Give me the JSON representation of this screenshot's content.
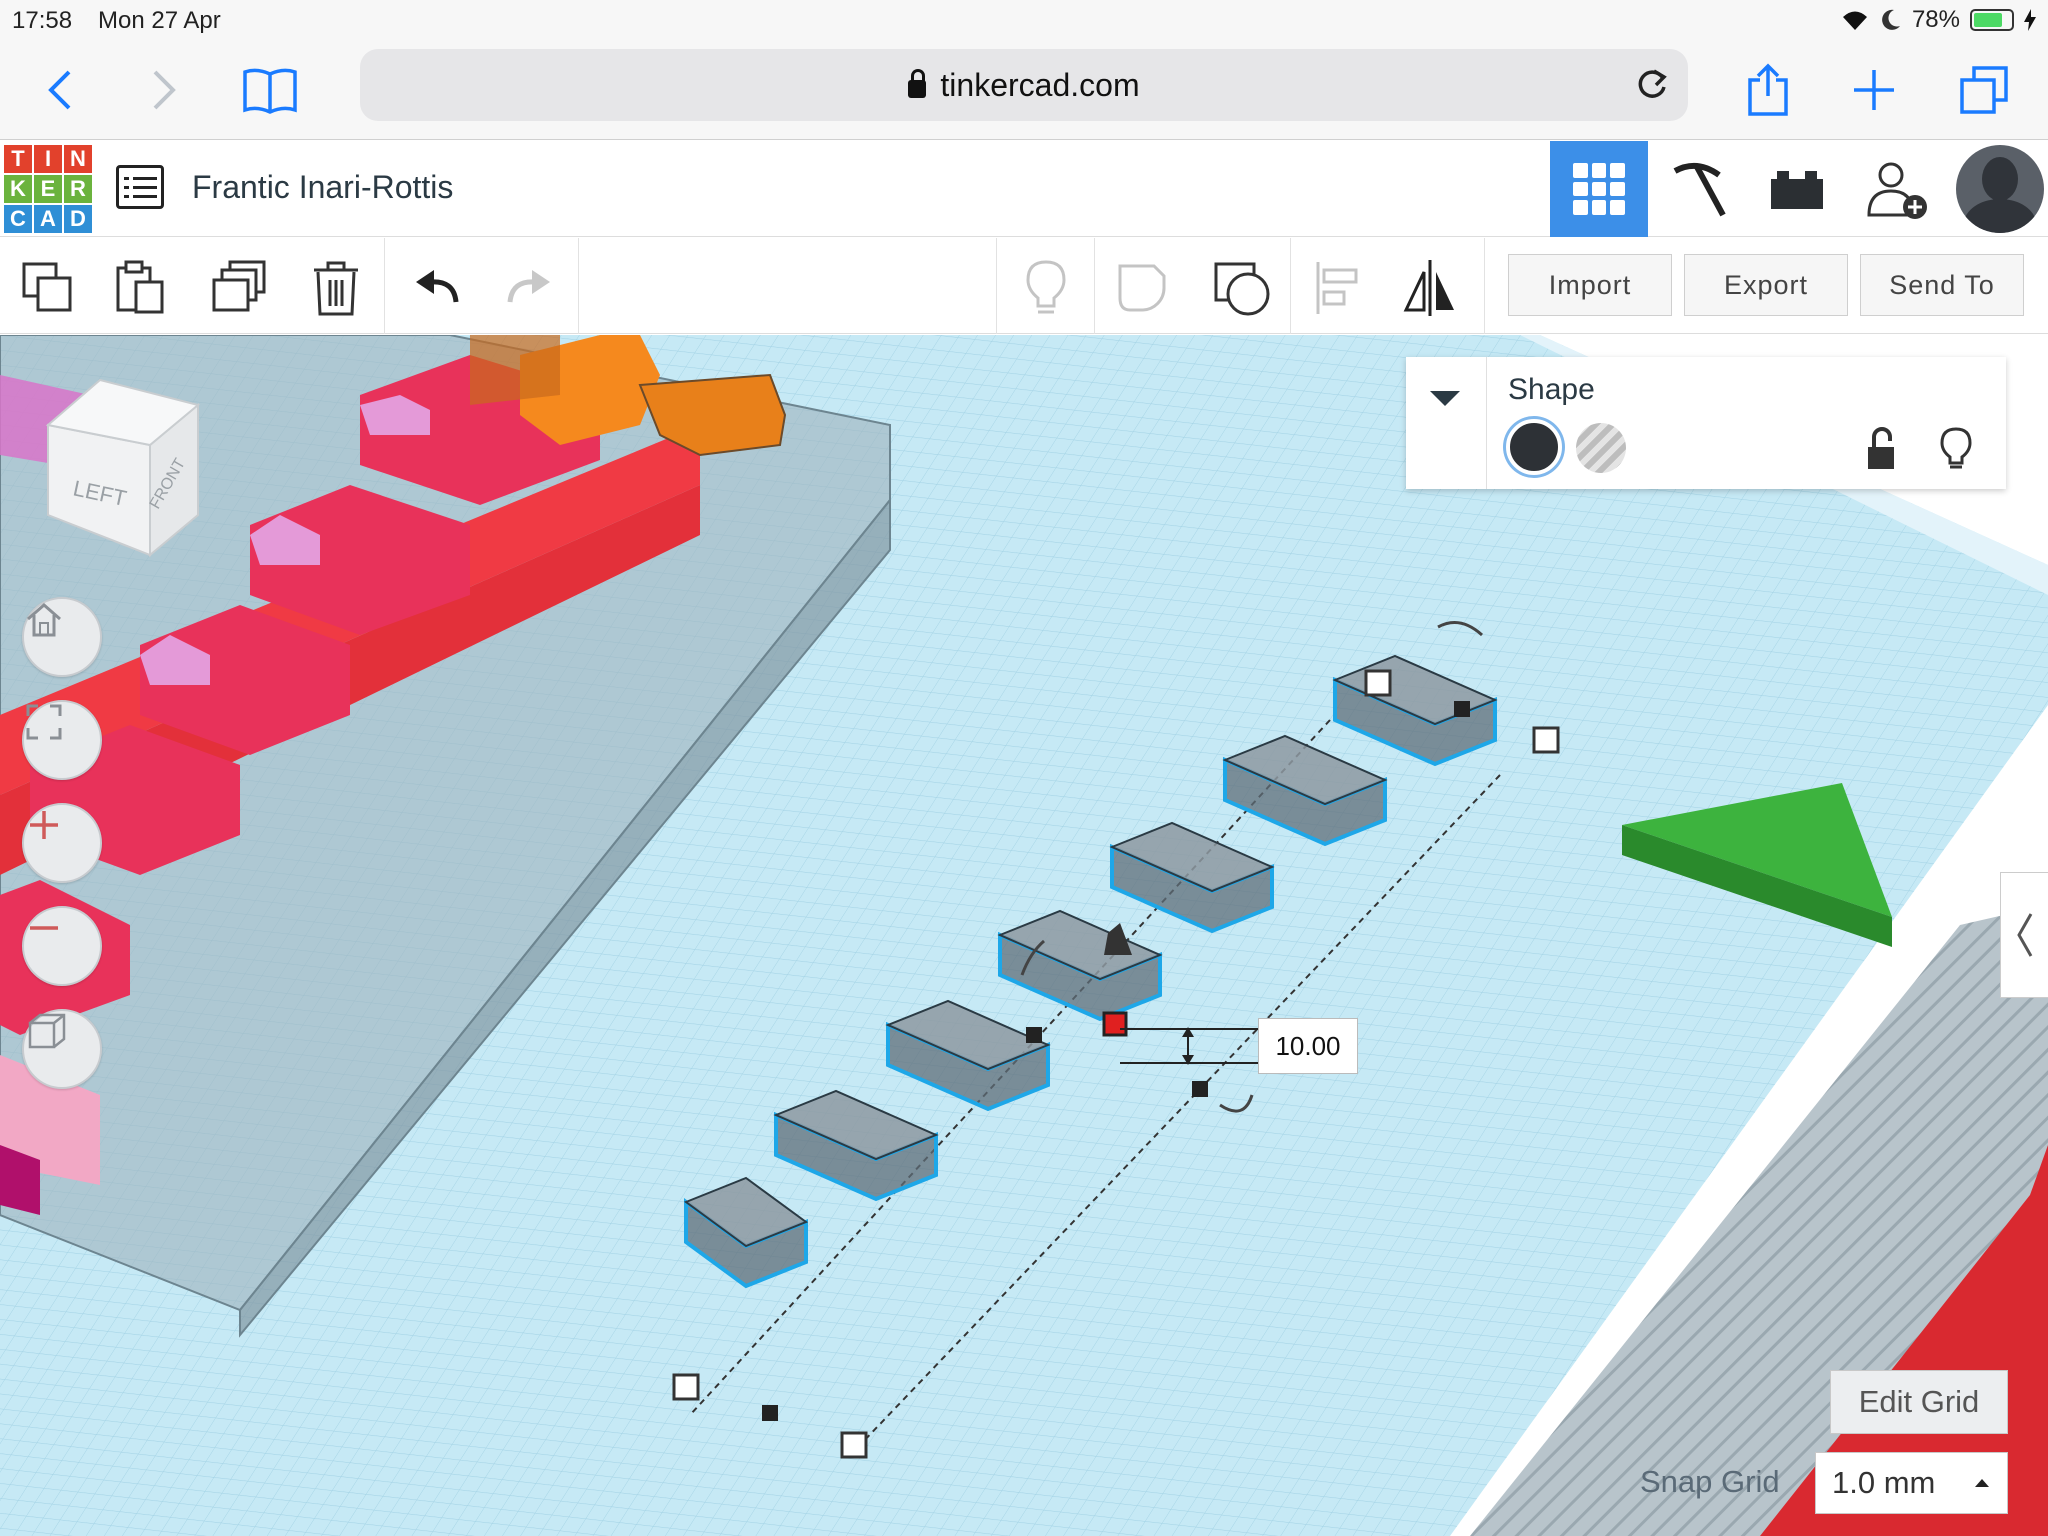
{
  "status_bar": {
    "time": "17:58",
    "date": "Mon 27 Apr",
    "battery": "78%",
    "battery_level": 0.78
  },
  "browser": {
    "url": "tinkercad.com",
    "icons": [
      "back-icon",
      "forward-icon",
      "bookmarks-icon",
      "lock-icon",
      "reload-icon",
      "share-icon",
      "new-tab-icon",
      "tabs-icon"
    ]
  },
  "app": {
    "logo_letters": [
      "T",
      "I",
      "N",
      "K",
      "E",
      "R",
      "C",
      "A",
      "D"
    ],
    "logo_colors": [
      "#e2412c",
      "#e2412c",
      "#e2412c",
      "#6bb33d",
      "#6bb33d",
      "#6bb33d",
      "#2f8fd6",
      "#2f8fd6",
      "#2f8fd6"
    ],
    "design_title": "Frantic Inari-Rottis",
    "header_modes": [
      "3d-design-view",
      "tools-view",
      "bricks-view"
    ],
    "accent": "#3c8fe8"
  },
  "toolbar": {
    "buttons": [
      "copy-button",
      "paste-button",
      "duplicate-button",
      "delete-button",
      "undo-button",
      "redo-button",
      "notes-button",
      "group-button",
      "ungroup-button",
      "align-button",
      "mirror-button"
    ],
    "import_label": "Import",
    "export_label": "Export",
    "sendto_label": "Send To"
  },
  "view_cube": {
    "left": "LEFT",
    "front": "FRONT"
  },
  "view_controls": [
    "home-view-button",
    "fit-view-button",
    "zoom-in-button",
    "zoom-out-button",
    "ortho-view-button"
  ],
  "inspector": {
    "title": "Shape",
    "solid_color": "#2d3136"
  },
  "canvas": {
    "dimension_value": "10.00",
    "grid_color": "#bde4f2",
    "selection_color": "#1ea7e8"
  },
  "grid_controls": {
    "edit_grid_label": "Edit Grid",
    "snap_label": "Snap Grid",
    "snap_value": "1.0 mm"
  }
}
